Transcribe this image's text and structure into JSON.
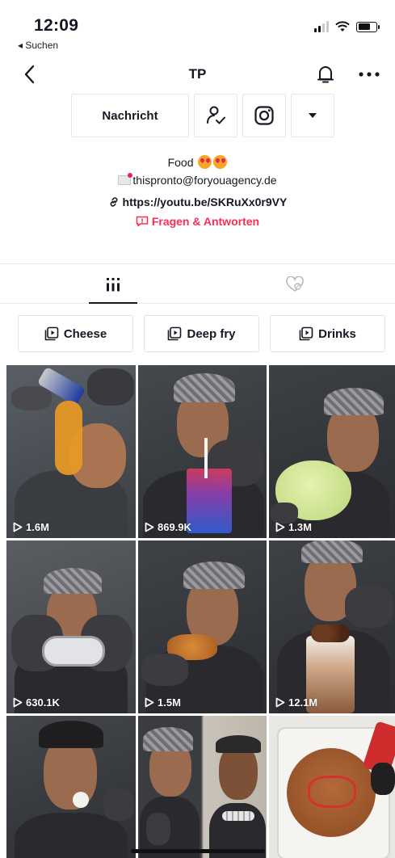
{
  "status": {
    "time": "12:09",
    "back_app": "◂ Suchen"
  },
  "nav": {
    "title": "TP"
  },
  "actions": {
    "message": "Nachricht"
  },
  "bio": {
    "line1": "Food",
    "email": "thispronto@foryouagency.de",
    "link": "https://youtu.be/SKRuXx0r9VY",
    "qa": "Fragen & Antworten"
  },
  "playlists": [
    {
      "label": "Cheese"
    },
    {
      "label": "Deep fry"
    },
    {
      "label": "Drinks"
    }
  ],
  "videos": [
    {
      "views": "1.6M"
    },
    {
      "views": "869.9K"
    },
    {
      "views": "1.3M"
    },
    {
      "views": "630.1K"
    },
    {
      "views": "1.5M"
    },
    {
      "views": "12.1M"
    }
  ],
  "colors": {
    "accent": "#fe2c55",
    "text": "#161823"
  }
}
